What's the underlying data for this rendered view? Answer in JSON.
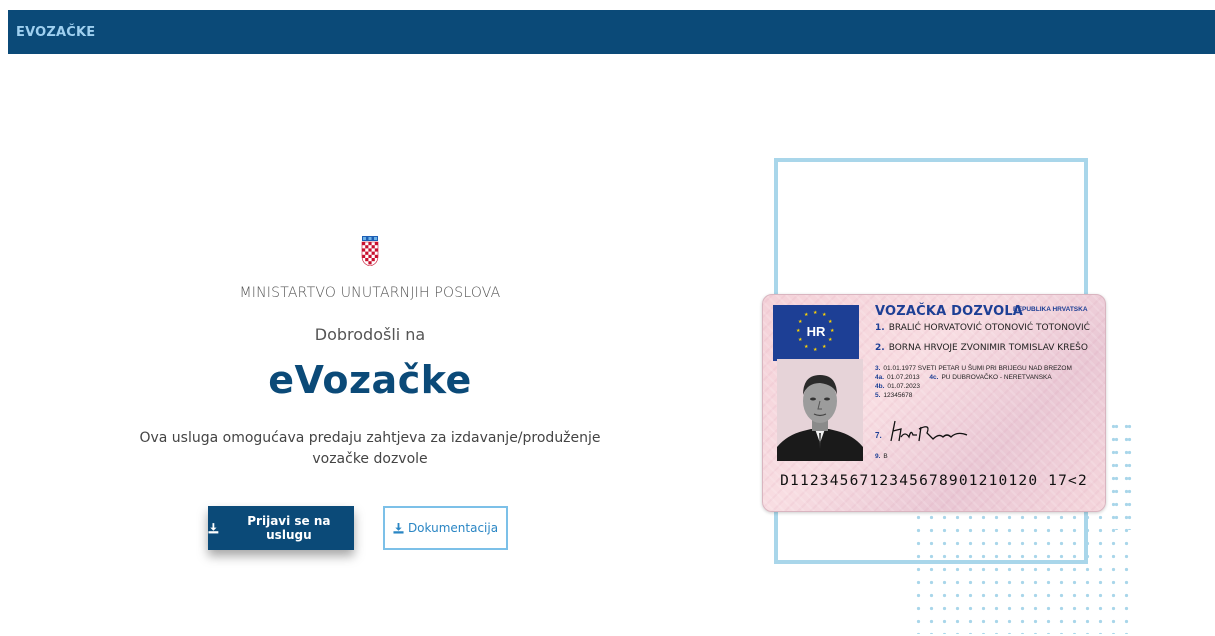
{
  "header": {
    "brand": "EVOZAČKE"
  },
  "main": {
    "ministry": "MINISTARTVO UNUTARNJIH POSLOVA",
    "welcome": "Dobrodošli na",
    "app_title": "eVozačke",
    "description": "Ova usluga omogućava predaju zahtjeva za izdavanje/produženje vozačke dozvole",
    "login_button": "Prijavi se na uslugu",
    "docs_button": "Dokumentacija"
  },
  "license_card": {
    "country_code": "HR",
    "title": "VOZAČKA DOZVOLA",
    "country": "REPUBLIKA HRVATSKA",
    "line1_num": "1.",
    "line1": "BRALIĆ HORVATOVIĆ OTONOVIĆ TOTONOVIĆ",
    "line2_num": "2.",
    "line2": "BORNA HRVOJE ZVONIMIR TOMISLAV KREŠO",
    "line3_num": "3.",
    "line3": "01.01.1977 SVETI PETAR U ŠUMI PRI BRIJEGU NAD BREZOM",
    "line4a_num": "4a.",
    "line4a": "01.07.2013",
    "line4c_num": "4c.",
    "line4c": "PU DUBROVAČKO - NERETVANSKA",
    "line4b_num": "4b.",
    "line4b": "01.07.2023",
    "line5_num": "5.",
    "line5": "12345678",
    "line7_num": "7.",
    "line9_num": "9.",
    "line9": "B",
    "mrz": "D1123456712345678901210120 17<2"
  },
  "colors": {
    "header_bg": "#0b4a78",
    "brand_text": "#9fd0f0",
    "primary": "#0b4a78",
    "accent_light": "#a9d6ea"
  }
}
